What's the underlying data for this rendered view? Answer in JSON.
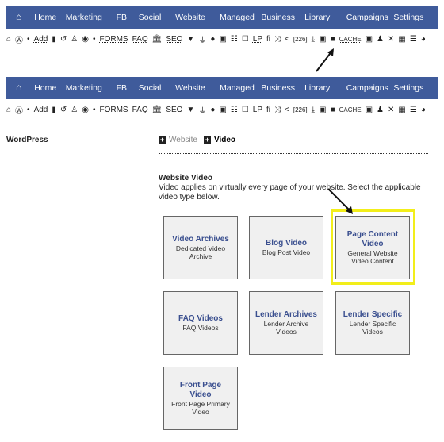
{
  "nav": {
    "items": [
      "Home",
      "Marketing",
      "FB",
      "Social",
      "Website",
      "Managed",
      "Business",
      "Library",
      "Campaigns",
      "Settings"
    ]
  },
  "toolbar": {
    "add": "Add",
    "forms": "FORMS",
    "faq": "FAQ",
    "seo": "SEO",
    "lp": "LP",
    "count": "[226]",
    "cache": "CACHE"
  },
  "sidebar": {
    "label": "WordPress"
  },
  "breadcrumb": {
    "parent": "Website",
    "current": "Video"
  },
  "section": {
    "title": "Website Video",
    "description": "Video applies on virtually every page of your website. Select the applicable video type below."
  },
  "cards": [
    {
      "title": "Video Archives",
      "desc": "Dedicated Video Archive"
    },
    {
      "title": "Blog Video",
      "desc": "Blog Post Video"
    },
    {
      "title": "Page Content Video",
      "desc": "General Website Video Content"
    },
    {
      "title": "FAQ Videos",
      "desc": "FAQ Videos"
    },
    {
      "title": "Lender Archives",
      "desc": "Lender Archive Videos"
    },
    {
      "title": "Lender Specific",
      "desc": "Lender Specific Videos"
    },
    {
      "title": "Front Page Video",
      "desc": "Front Page Primary Video"
    }
  ],
  "colors": {
    "nav": "#3f5b9b",
    "highlight": "#f2ee1a",
    "card_title": "#3a4f8f"
  }
}
